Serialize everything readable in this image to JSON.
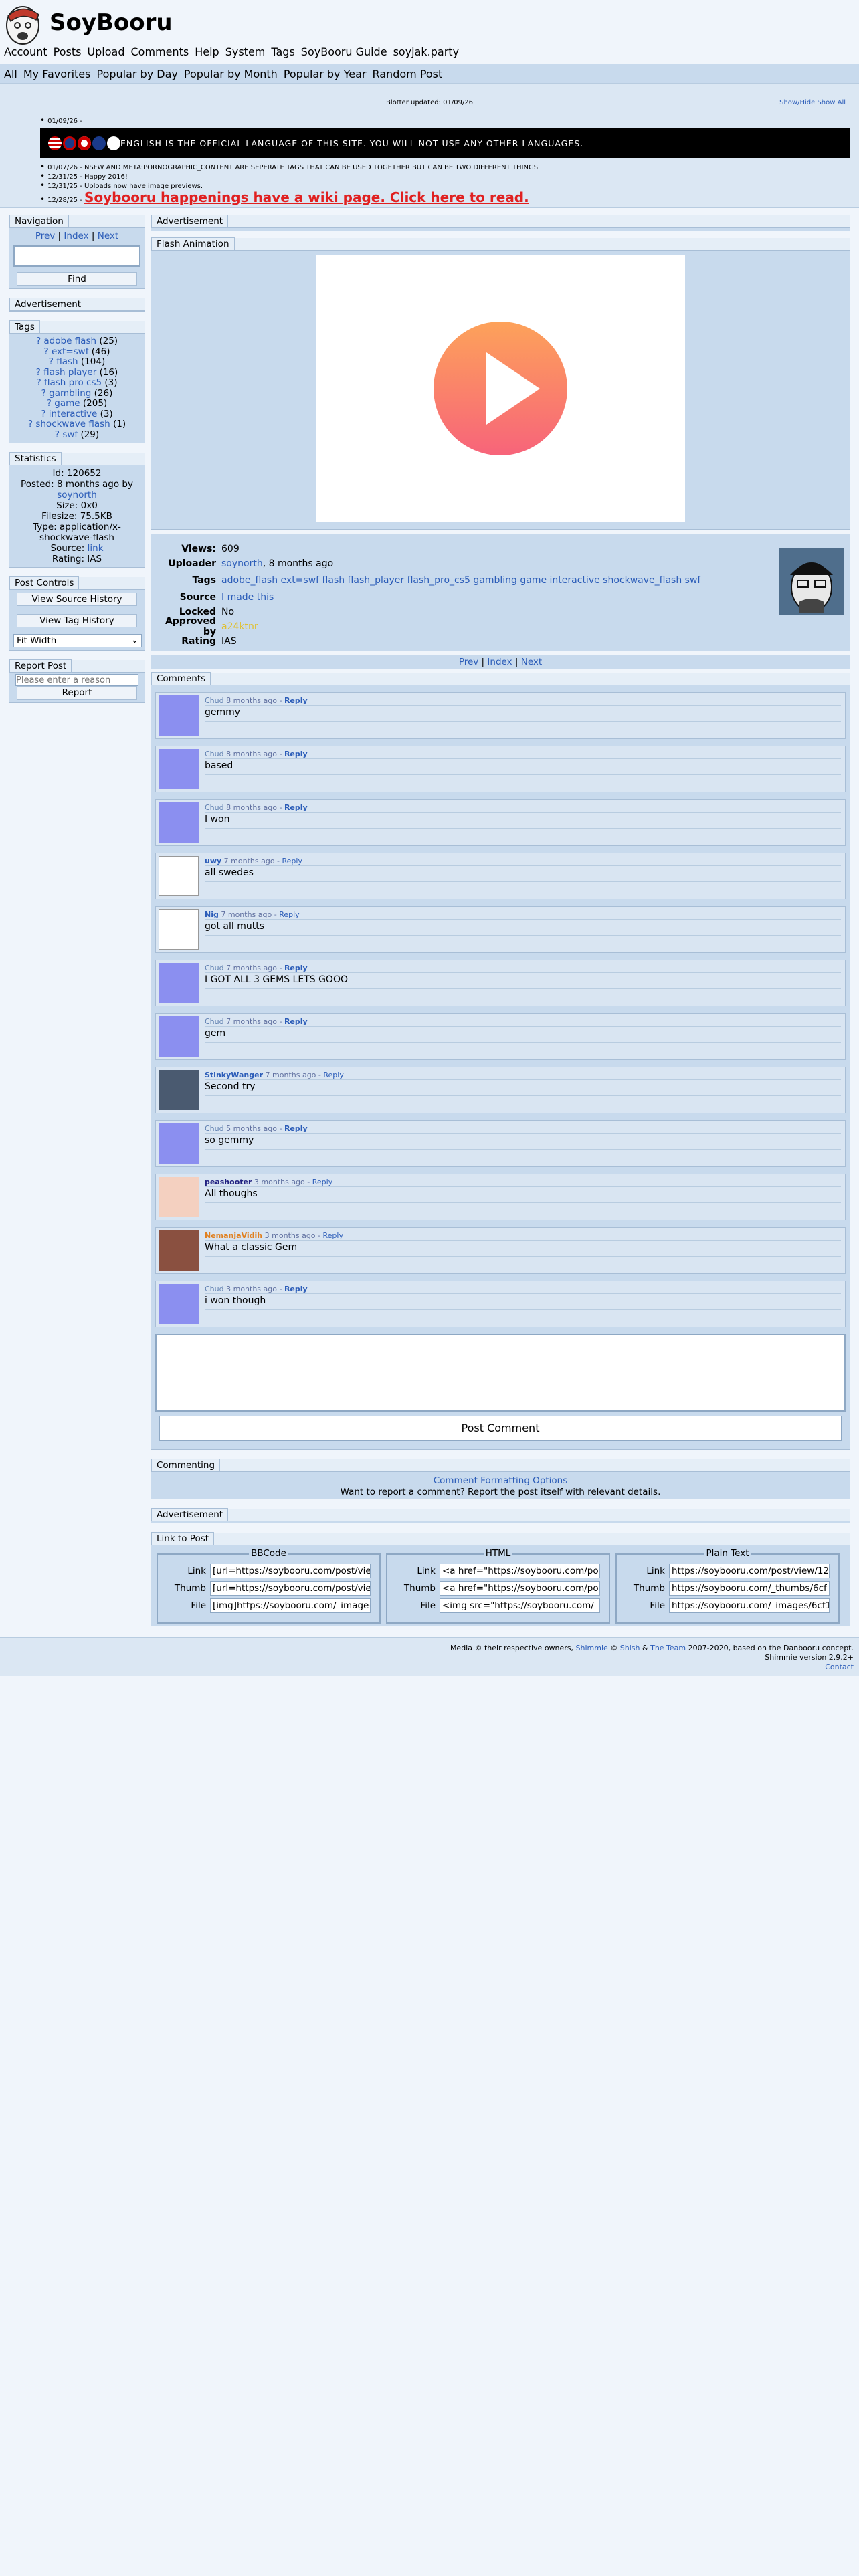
{
  "site": {
    "title": "SoyBooru"
  },
  "nav": {
    "main": [
      "Account",
      "Posts",
      "Upload",
      "Comments",
      "Help",
      "System",
      "Tags",
      "SoyBooru Guide",
      "soyjak.party"
    ],
    "sub": [
      "All",
      "My Favorites",
      "Popular by Day",
      "Popular by Month",
      "Popular by Year",
      "Random Post"
    ]
  },
  "blotter": {
    "updated": "Blotter updated: 01/09/26",
    "toggle": "Show/Hide Show All",
    "entry1_date": "01/09/26 -",
    "banner_text": "ENGLISH IS THE OFFICIAL LANGUAGE OF THIS SITE. YOU WILL NOT USE ANY OTHER LANGUAGES.",
    "entry2": "01/07/26 - NSFW AND META:PORNOGRAPHIC_CONTENT ARE SEPERATE TAGS THAT CAN BE USED TOGETHER BUT CAN BE TWO DIFFERENT THINGS",
    "entry3": "12/31/25 - Happy 2016!",
    "entry4": "12/31/25 - Uploads now have image previews.",
    "entry5_date": "12/28/25 -",
    "entry5_link": "Soybooru happenings have a wiki page. Click here to read."
  },
  "sidebar": {
    "nav_title": "Navigation",
    "prev": "Prev",
    "index": "Index",
    "next": "Next",
    "find": "Find",
    "ad_title": "Advertisement",
    "tags_title": "Tags",
    "tags": [
      {
        "name": "adobe flash",
        "count": "(25)"
      },
      {
        "name": "ext=swf",
        "count": "(46)"
      },
      {
        "name": "flash",
        "count": "(104)"
      },
      {
        "name": "flash player",
        "count": "(16)"
      },
      {
        "name": "flash pro cs5",
        "count": "(3)"
      },
      {
        "name": "gambling",
        "count": "(26)"
      },
      {
        "name": "game",
        "count": "(205)"
      },
      {
        "name": "interactive",
        "count": "(3)"
      },
      {
        "name": "shockwave flash",
        "count": "(1)"
      },
      {
        "name": "swf",
        "count": "(29)"
      }
    ],
    "stats_title": "Statistics",
    "stats": {
      "id": "Id: 120652",
      "posted": "Posted: 8 months ago by",
      "poster": "soynorth",
      "size": "Size: 0x0",
      "filesize": "Filesize: 75.5KB",
      "type": "Type: application/x-shockwave-flash",
      "source_label": "Source:",
      "source_link": "link",
      "rating": "Rating: IAS"
    },
    "controls_title": "Post Controls",
    "source_history": "View Source History",
    "tag_history": "View Tag History",
    "fit": "Fit Width",
    "report_title": "Report Post",
    "report_placeholder": "Please enter a reason",
    "report_btn": "Report"
  },
  "main": {
    "ad_title": "Advertisement",
    "flash_title": "Flash Animation",
    "info": {
      "views_label": "Views:",
      "views": "609",
      "uploader_label": "Uploader",
      "uploader": "soynorth",
      "uploader_when": ", 8 months ago",
      "tags_label": "Tags",
      "tags": "adobe_flash ext=swf flash flash_player flash_pro_cs5 gambling game interactive shockwave_flash swf",
      "source_label": "Source",
      "source": "I made this",
      "locked_label": "Locked",
      "locked": "No",
      "approved_label": "Approved by",
      "approved": "a24ktnr",
      "rating_label": "Rating",
      "rating": "IAS"
    },
    "pager": {
      "prev": "Prev",
      "index": "Index",
      "next": "Next"
    },
    "comments_title": "Comments",
    "comments": [
      {
        "name": "Chud",
        "when": " 8 months ago - ",
        "reply": "Reply",
        "text": "gemmy"
      },
      {
        "name": "Chud",
        "when": " 8 months ago - ",
        "reply": "Reply",
        "text": "based"
      },
      {
        "name": "Chud",
        "when": " 8 months ago - ",
        "reply": "Reply",
        "text": "I won"
      },
      {
        "name": "uwy",
        "when": " 7 months ago - ",
        "reply": "Reply",
        "text": "all swedes"
      },
      {
        "name": "Nig",
        "when": " 7 months ago - ",
        "reply": "Reply",
        "text": "got all mutts"
      },
      {
        "name": "Chud",
        "when": " 7 months ago - ",
        "reply": "Reply",
        "text": "I GOT ALL 3 GEMS LETS GOOO"
      },
      {
        "name": "Chud",
        "when": " 7 months ago - ",
        "reply": "Reply",
        "text": "gem"
      },
      {
        "name": "StinkyWanger",
        "when": " 7 months ago - ",
        "reply": "Reply",
        "text": "Second try"
      },
      {
        "name": "Chud",
        "when": " 5 months ago - ",
        "reply": "Reply",
        "text": "so gemmy"
      },
      {
        "name": "peashooter",
        "when": " 3 months ago - ",
        "reply": "Reply",
        "text": "All thoughs"
      },
      {
        "name": "NemanjaVidih",
        "when": " 3 months ago - ",
        "reply": "Reply",
        "text": "What a classic Gem"
      },
      {
        "name": "Chud",
        "when": " 3 months ago - ",
        "reply": "Reply",
        "text": "i won though"
      }
    ],
    "post_comment": "Post Comment",
    "commenting_title": "Commenting",
    "formatting_link": "Comment Formatting Options",
    "report_note": "Want to report a comment? Report the post itself with relevant details.",
    "ad2_title": "Advertisement",
    "link_title": "Link to Post",
    "bbcode": {
      "legend": "BBCode",
      "link": "[url=https://soybooru.com/post/vie",
      "thumb": "[url=https://soybooru.com/post/vie",
      "file": "[img]https://soybooru.com/_image-"
    },
    "html": {
      "legend": "HTML",
      "link": "<a href=\"https://soybooru.com/po",
      "thumb": "<a href=\"https://soybooru.com/po",
      "file": "<img src=\"https://soybooru.com/_"
    },
    "plain": {
      "legend": "Plain Text",
      "link": "https://soybooru.com/post/view/12",
      "thumb": "https://soybooru.com/_thumbs/6cf",
      "file": "https://soybooru.com/_images/6cf1"
    },
    "row_labels": {
      "link": "Link",
      "thumb": "Thumb",
      "file": "File"
    }
  },
  "footer": {
    "line1a": "Media © their respective owners, ",
    "shish": "Shimmie",
    "by": " © ",
    "shish2": "Shish",
    "amp": " & ",
    "team": "The Team",
    "line1b": " 2007-2020, based on the Danbooru concept.",
    "line2": "Shimmie version 2.9.2+",
    "contact": "Contact"
  }
}
